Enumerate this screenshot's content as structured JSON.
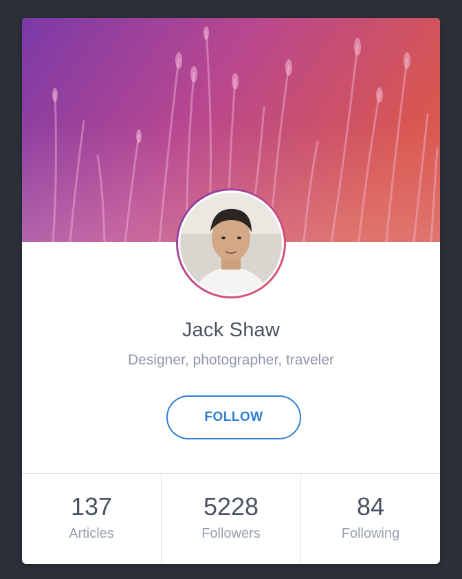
{
  "profile": {
    "name": "Jack Shaw",
    "bio": "Designer, photographer, traveler",
    "follow_label": "FOLLOW"
  },
  "stats": [
    {
      "value": "137",
      "label": "Articles"
    },
    {
      "value": "5228",
      "label": "Followers"
    },
    {
      "value": "84",
      "label": "Following"
    }
  ],
  "colors": {
    "background": "#2b2f38",
    "card": "#ffffff",
    "accent_blue": "#2f7fd1",
    "cover_gradient_start": "#7b3aa8",
    "cover_gradient_mid": "#c0478f",
    "cover_gradient_end": "#d9574f",
    "text_primary": "#4a5262",
    "text_secondary": "#8f97a6"
  }
}
